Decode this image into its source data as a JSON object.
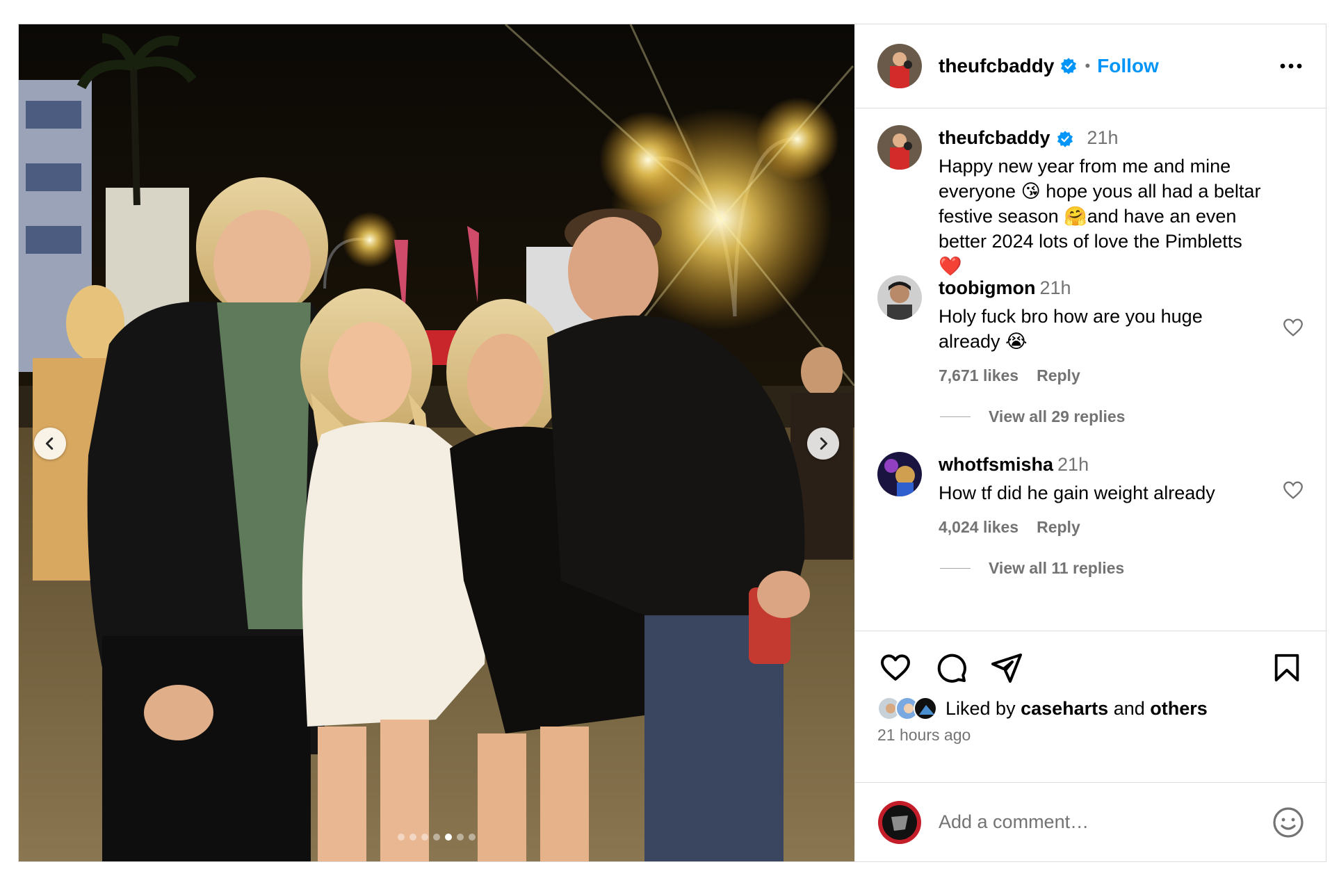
{
  "post": {
    "author": "theufcbaddy",
    "follow_label": "Follow",
    "separator": "•",
    "media_dots": 7,
    "active_dot": 5
  },
  "caption": {
    "user": "theufcbaddy",
    "time": "21h",
    "line1": "Happy new year from me and mine",
    "line2": "everyone 😘 hope yous all had a beltar",
    "line3": "festive season 🤗and have an even",
    "line4": "better 2024 lots of love the Pimbletts",
    "line5": "❤️"
  },
  "comments": [
    {
      "user": "toobigmon",
      "time": "21h",
      "line1": "Holy fuck bro how are you huge",
      "line2": "already 😭",
      "likes": "7,671 likes",
      "reply": "Reply",
      "view_replies": "View all 29 replies"
    },
    {
      "user": "whotfsmisha",
      "time": "21h",
      "line1": "How tf did he gain weight already",
      "likes": "4,024 likes",
      "reply": "Reply",
      "view_replies": "View all 11 replies"
    }
  ],
  "actions": {
    "liked_prefix": "Liked by",
    "liked_user": "caseharts",
    "liked_and": "and",
    "liked_others": "others",
    "timestamp": "21 hours ago"
  },
  "add_comment": {
    "placeholder": "Add a comment…"
  },
  "icons": {
    "verified": "verified-badge-icon",
    "more": "more-options-icon",
    "like": "heart-icon",
    "comment": "comment-icon",
    "share": "share-icon",
    "save": "bookmark-icon",
    "emoji": "emoji-icon",
    "prev": "chevron-left-icon",
    "next": "chevron-right-icon"
  },
  "colors": {
    "link_blue": "#0095f6",
    "muted": "#737373",
    "border": "#dbdbdb",
    "heart_red": "#e0245e"
  }
}
